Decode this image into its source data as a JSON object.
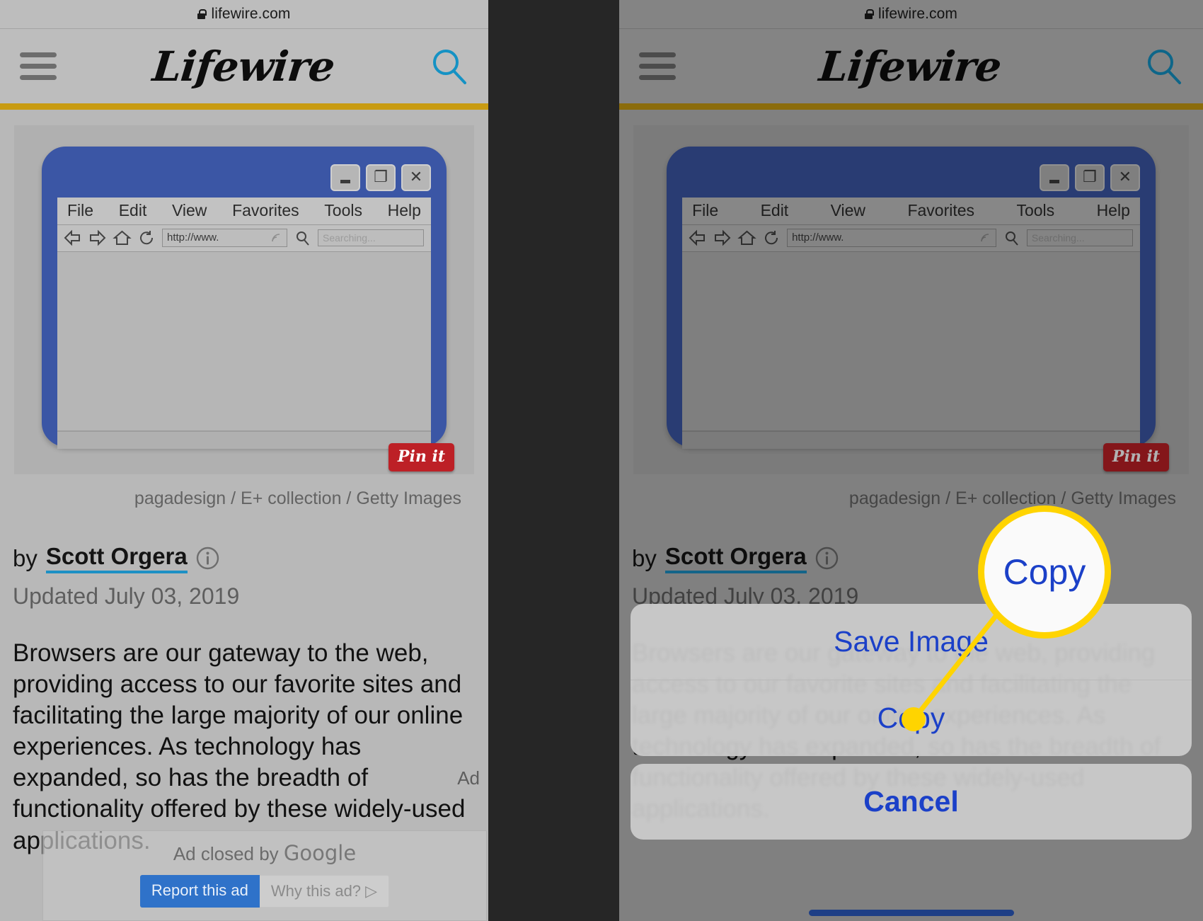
{
  "browser": {
    "url": "lifewire.com",
    "lock_icon": "lock-icon"
  },
  "site_header": {
    "menu_icon": "hamburger-menu-icon",
    "logo": "Lifewire",
    "search_icon": "search-icon",
    "accent_gold": "#c89b12"
  },
  "figure": {
    "illustration": {
      "window_buttons": [
        "minimize-icon",
        "restore-icon",
        "close-icon"
      ],
      "menu_items": [
        "File",
        "Edit",
        "View",
        "Favorites",
        "Tools",
        "Help"
      ],
      "nav_icons": [
        "back-arrow-icon",
        "forward-arrow-icon",
        "home-icon",
        "refresh-icon"
      ],
      "address_value": "http://www.",
      "rss_icon": "rss-icon",
      "search_glass_icon": "magnifier-icon",
      "search_placeholder": "Searching...",
      "frame_color": "#3b56a5"
    },
    "pin_it_label": "Pin it",
    "caption": "pagadesign / E+ collection / Getty Images"
  },
  "article": {
    "by_prefix": "by",
    "author": "Scott Orgera",
    "info_icon": "info-icon",
    "updated": "Updated July 03, 2019",
    "body": "Browsers are our gateway to the web, providing access to our favorite sites and facilitating the large majority of our online experiences. As technology has expanded, so has the breadth of functionality offered by these widely-used applications."
  },
  "ad": {
    "tag_label": "Ad",
    "closed_text_prefix": "Ad closed by",
    "closed_text_brand": "Google",
    "report_label": "Report this ad",
    "why_label": "Why this ad? ▷"
  },
  "action_sheet": {
    "items": [
      {
        "label": "Save Image",
        "name": "save-image-option"
      },
      {
        "label": "Copy",
        "name": "copy-option"
      }
    ],
    "cancel_label": "Cancel"
  },
  "callout": {
    "magnified_label": "Copy",
    "highlight_color": "#ffd400"
  }
}
